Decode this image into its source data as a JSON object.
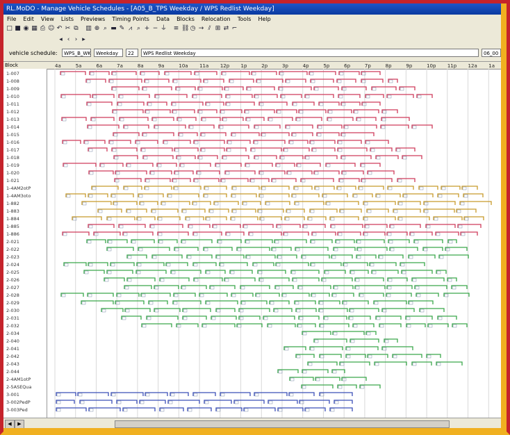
{
  "window": {
    "title": "RL.MoDO - Manage Vehicle Schedules - [A05_B_TPS Weekday / WPS Redlist Weekday]"
  },
  "menu": [
    "File",
    "Edit",
    "View",
    "Lists",
    "Previews",
    "Timing Points",
    "Data",
    "Blocks",
    "Relocation",
    "Tools",
    "Help"
  ],
  "toolbar": {
    "row1_icons": [
      "new-icon",
      "save-icon",
      "open-icon",
      "grid-icon",
      "print-icon",
      "user-icon",
      "undo-icon",
      "cut-icon",
      "copy-icon",
      "chart-icon",
      "zoom-icon",
      "find-icon",
      "bus-icon",
      "pencil-icon",
      "graph-icon",
      "search-icon",
      "zoom-in-icon",
      "zoom-out-icon",
      "filter-icon",
      "list-icon",
      "link-icon",
      "clock-icon",
      "arrow-icon",
      "split-icon",
      "join-icon",
      "swap-icon",
      "hook-icon"
    ],
    "row2_icons": [
      "first-icon",
      "prev-icon",
      "next-icon",
      "last-icon"
    ]
  },
  "schedule_bar": {
    "label": "vehicle schedule:",
    "code": "WPS_B_WK",
    "day": "Weekday",
    "number": "22",
    "description": "WPS Redlist Weekday",
    "right_field": "06_00"
  },
  "header": {
    "block_label": "Block",
    "time_ticks": [
      "4a",
      "5a",
      "6a",
      "7a",
      "8a",
      "9a",
      "10a",
      "11a",
      "12p",
      "1p",
      "2p",
      "3p",
      "4p",
      "5p",
      "6p",
      "7p",
      "8p",
      "9p",
      "10p",
      "11p",
      "12a",
      "1a"
    ]
  },
  "blocks": [
    {
      "label": "1-007",
      "color": "#cf3b5a"
    },
    {
      "label": "1-008",
      "color": "#cf3b5a"
    },
    {
      "label": "1-009",
      "color": "#cf3b5a"
    },
    {
      "label": "1-010",
      "color": "#cf3b5a"
    },
    {
      "label": "1-011",
      "color": "#cf3b5a"
    },
    {
      "label": "1-012",
      "color": "#cf3b5a"
    },
    {
      "label": "1-013",
      "color": "#cf3b5a"
    },
    {
      "label": "1-014",
      "color": "#cf3b5a"
    },
    {
      "label": "1-015",
      "color": "#cf3b5a"
    },
    {
      "label": "1-016",
      "color": "#cf3b5a"
    },
    {
      "label": "1-017",
      "color": "#cf3b5a"
    },
    {
      "label": "1-018",
      "color": "#cf3b5a"
    },
    {
      "label": "1-019",
      "color": "#cf3b5a"
    },
    {
      "label": "1-020",
      "color": "#cf3b5a"
    },
    {
      "label": "1-021",
      "color": "#cf3b5a"
    },
    {
      "label": "1-4AM2otP",
      "color": "#c89a2a"
    },
    {
      "label": "1-4AM3oto",
      "color": "#c89a2a"
    },
    {
      "label": "1-882",
      "color": "#c89a2a"
    },
    {
      "label": "1-883",
      "color": "#c89a2a"
    },
    {
      "label": "1-884",
      "color": "#c89a2a"
    },
    {
      "label": "1-885",
      "color": "#cf3b5a"
    },
    {
      "label": "1-886",
      "color": "#cf3b5a"
    },
    {
      "label": "2-021",
      "color": "#3aa84a"
    },
    {
      "label": "2-022",
      "color": "#3aa84a"
    },
    {
      "label": "2-023",
      "color": "#3aa84a"
    },
    {
      "label": "2-024",
      "color": "#3aa84a"
    },
    {
      "label": "2-025",
      "color": "#3aa84a"
    },
    {
      "label": "2-026",
      "color": "#3aa84a"
    },
    {
      "label": "2-027",
      "color": "#3aa84a"
    },
    {
      "label": "2-028",
      "color": "#3aa84a"
    },
    {
      "label": "2-029",
      "color": "#3aa84a"
    },
    {
      "label": "2-030",
      "color": "#3aa84a"
    },
    {
      "label": "2-031",
      "color": "#3aa84a"
    },
    {
      "label": "2-032",
      "color": "#3aa84a"
    },
    {
      "label": "2-034",
      "color": "#3aa84a"
    },
    {
      "label": "2-040",
      "color": "#3aa84a"
    },
    {
      "label": "2-041",
      "color": "#3aa84a"
    },
    {
      "label": "2-042",
      "color": "#3aa84a"
    },
    {
      "label": "2-043",
      "color": "#3aa84a"
    },
    {
      "label": "2-044",
      "color": "#3aa84a"
    },
    {
      "label": "2-4AM1otP",
      "color": "#3aa84a"
    },
    {
      "label": "2-5ASEQua",
      "color": "#3aa84a"
    },
    {
      "label": "3-001",
      "color": "#3b4fb8"
    },
    {
      "label": "3-002PedP",
      "color": "#3b4fb8"
    },
    {
      "label": "3-003Ped",
      "color": "#3b4fb8"
    }
  ],
  "colors": {
    "frame_red": "#c5232b",
    "frame_gold": "#f0b020",
    "red_line": "#cf3b5a",
    "gold_line": "#c89a2a",
    "green_line": "#3aa84a",
    "blue_line": "#3b4fb8"
  }
}
